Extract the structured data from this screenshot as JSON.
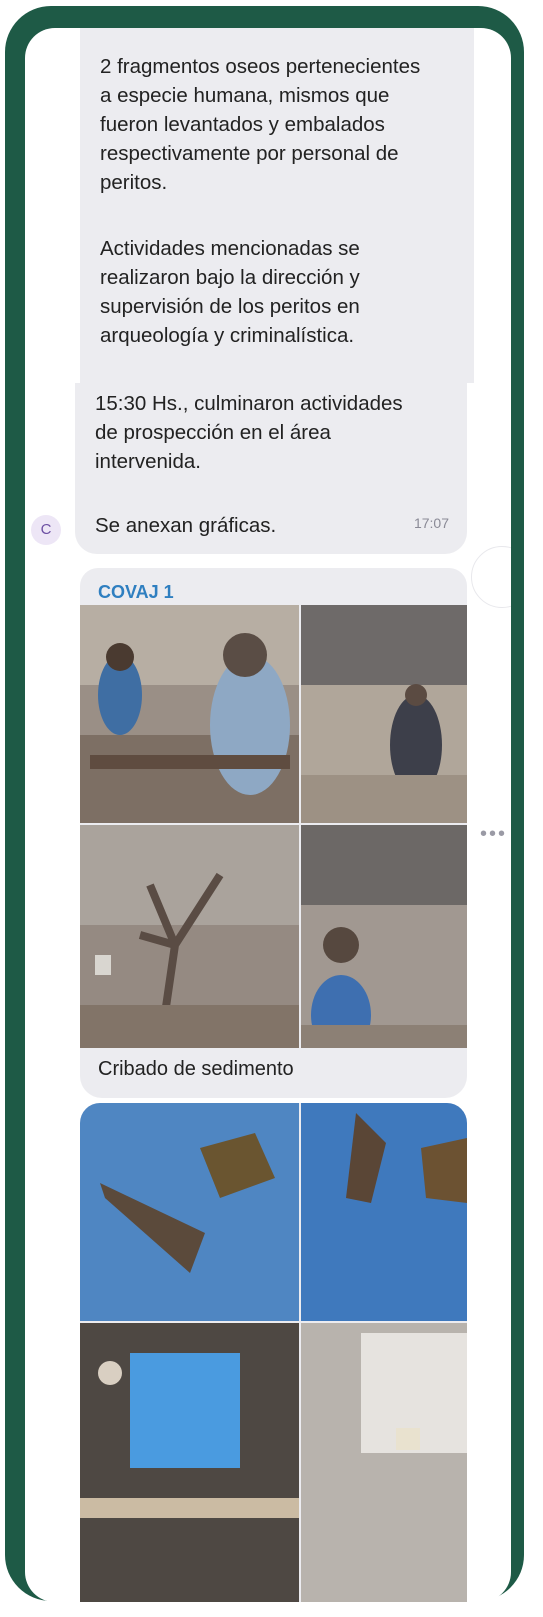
{
  "messages": {
    "first_paragraph_lines": [
      "2 fragmentos oseos pertenecientes",
      "a especie humana, mismos que",
      "fueron levantados y embalados",
      "respectivamente por personal de",
      "peritos."
    ],
    "second_paragraph_lines": [
      "Actividades mencionadas se",
      "realizaron bajo la dirección y",
      "supervisión de los peritos en",
      "arqueología y criminalística."
    ],
    "third_paragraph_lines": [
      "15:30 Hs., culminaron actividades",
      "de prospección en el área",
      "intervenida."
    ],
    "closing_line": "Se anexan gráficas.",
    "timestamp": "17:07"
  },
  "avatar": {
    "initial": "C",
    "color": "#6c4fa3"
  },
  "album": {
    "sender": "COVAJ 1",
    "caption": "Cribado de sedimento",
    "photo_count": 4
  },
  "album2": {
    "photo_count": 4
  },
  "more_options_icon": "ellipsis-icon",
  "colors": {
    "frame": "#1e5a46",
    "bubble": "#ececf0",
    "sender": "#2f7fc0"
  }
}
